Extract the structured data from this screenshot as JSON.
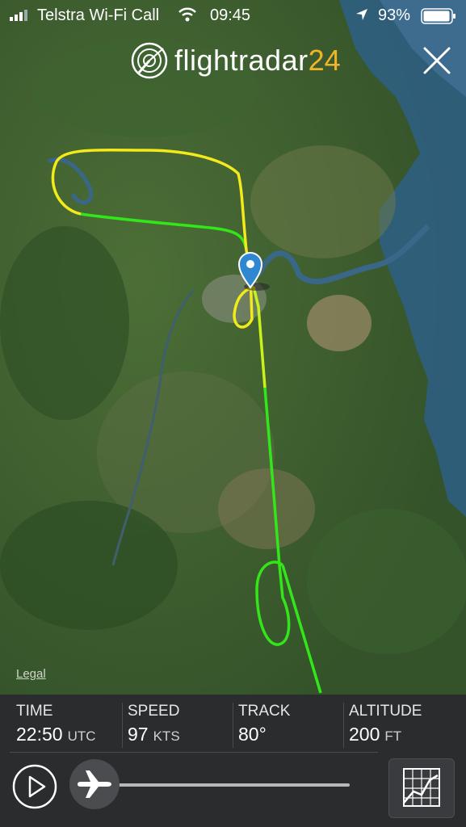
{
  "status_bar": {
    "carrier": "Telstra Wi-Fi Call",
    "time": "09:45",
    "battery": "93%"
  },
  "brand": {
    "name": "flightradar",
    "number": "24"
  },
  "map": {
    "legal": "Legal"
  },
  "stats": {
    "time": {
      "label": "TIME",
      "value": "22:50",
      "unit": "UTC"
    },
    "speed": {
      "label": "SPEED",
      "value": "97",
      "unit": "KTS"
    },
    "track": {
      "label": "TRACK",
      "value": "80°",
      "unit": ""
    },
    "altitude": {
      "label": "ALTITUDE",
      "value": "200",
      "unit": "FT"
    }
  },
  "colors": {
    "track_low": "#33e61a",
    "track_mid": "#c8f21a",
    "track_high": "#f2ea1a",
    "marker": "#2f86d1",
    "brand_accent": "#f0b429",
    "panel": "#2b2c2e"
  },
  "icons": [
    "signal-icon",
    "wifi-icon",
    "location-arrow-icon",
    "battery-icon",
    "radar-logo-icon",
    "close-icon",
    "play-icon",
    "airplane-icon",
    "chart-icon",
    "map-pin-icon"
  ]
}
